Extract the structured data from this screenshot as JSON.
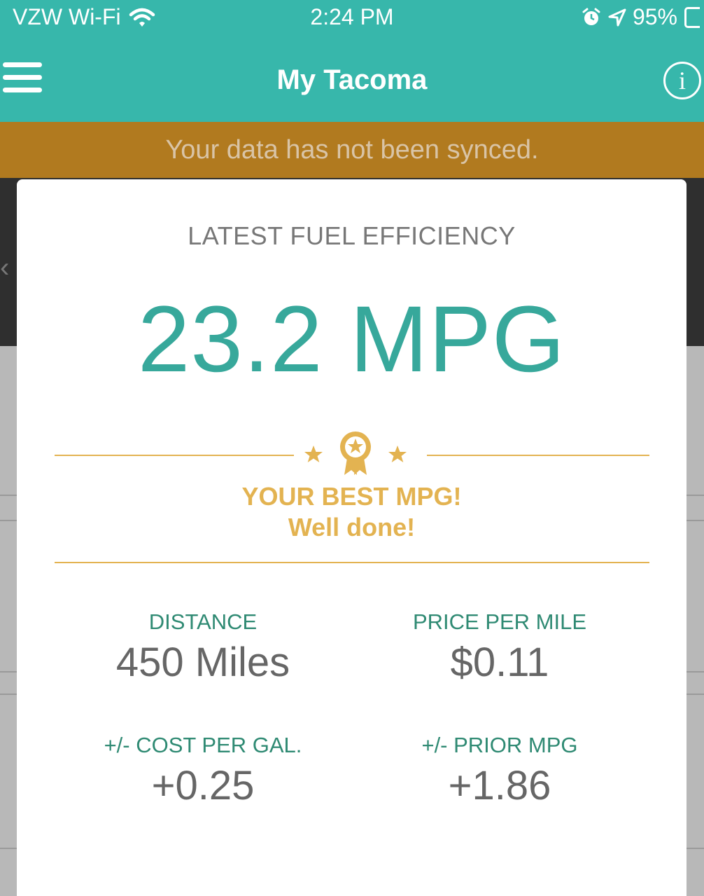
{
  "status_bar": {
    "carrier": "VZW Wi-Fi",
    "time": "2:24 PM",
    "battery": "95%"
  },
  "nav": {
    "title": "My Tacoma",
    "info_glyph": "i"
  },
  "banner": {
    "text": "Your data has not been synced."
  },
  "card": {
    "title": "LATEST FUEL EFFICIENCY",
    "mpg": "23.2 MPG",
    "award_title": "YOUR BEST MPG!",
    "award_sub": "Well done!",
    "stats": [
      {
        "label": "DISTANCE",
        "value": "450 Miles"
      },
      {
        "label": "PRICE PER MILE",
        "value": "$0.11"
      },
      {
        "label": "+/- COST PER GAL.",
        "value": "+0.25"
      },
      {
        "label": "+/- PRIOR MPG",
        "value": "+1.86"
      }
    ]
  },
  "colors": {
    "teal": "#37b7ab",
    "banner": "#b17a1f",
    "gold": "#e3b351",
    "mpg_text": "#37a89b",
    "stat_label": "#2f8a73"
  },
  "icons": [
    "wifi-icon",
    "alarm-icon",
    "location-arrow-icon",
    "battery-icon",
    "menu-icon",
    "info-icon",
    "award-ribbon-icon",
    "star-icon"
  ]
}
